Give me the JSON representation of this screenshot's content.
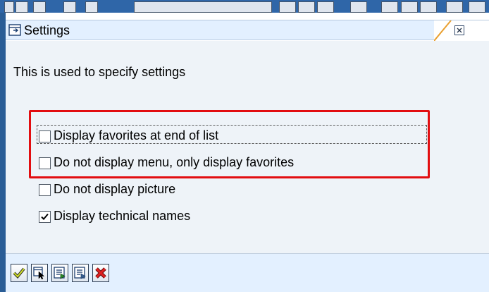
{
  "dialog": {
    "title": "Settings",
    "description": "This is used to specify settings",
    "options": [
      {
        "label": "Display favorites at end of list",
        "checked": false
      },
      {
        "label": "Do not display menu, only display favorites",
        "checked": false
      },
      {
        "label": "Do not display picture",
        "checked": false
      },
      {
        "label": "Display technical names",
        "checked": true
      }
    ]
  },
  "footer_buttons": [
    {
      "icon": "checkmark-icon"
    },
    {
      "icon": "select-icon"
    },
    {
      "icon": "document-add-icon"
    },
    {
      "icon": "document-list-icon"
    },
    {
      "icon": "cancel-icon"
    }
  ],
  "colors": {
    "titlebar": "#e3f0ff",
    "content": "#eef3f8",
    "highlight": "#e20d10",
    "window_border": "#2a5d96"
  }
}
